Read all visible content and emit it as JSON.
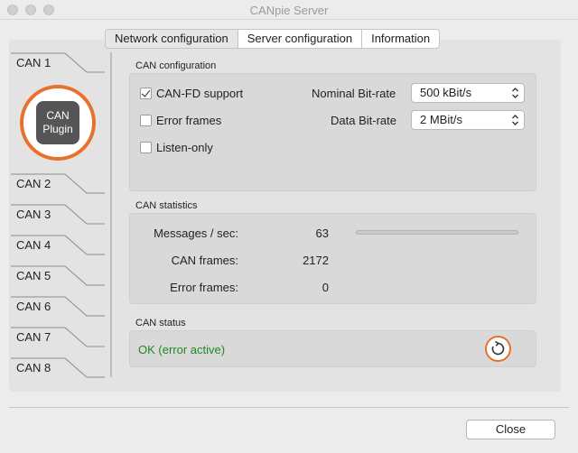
{
  "window": {
    "title": "CANpie Server"
  },
  "tabs": [
    "Network configuration",
    "Server configuration",
    "Information"
  ],
  "channels": [
    "CAN 1",
    "CAN 2",
    "CAN 3",
    "CAN 4",
    "CAN 5",
    "CAN 6",
    "CAN 7",
    "CAN 8"
  ],
  "plugin": {
    "line1": "CAN",
    "line2": "Plugin"
  },
  "can_config": {
    "title": "CAN configuration",
    "canfd_label": "CAN-FD support",
    "canfd_checked": true,
    "error_frames_label": "Error frames",
    "error_frames_checked": false,
    "listen_only_label": "Listen-only",
    "listen_only_checked": false,
    "nominal_label": "Nominal Bit-rate",
    "nominal_value": "500 kBit/s",
    "data_label": "Data Bit-rate",
    "data_value": "2 MBit/s"
  },
  "can_stats": {
    "title": "CAN statistics",
    "msg_label": "Messages / sec:",
    "msg_value": "63",
    "frames_label": "CAN frames:",
    "frames_value": "2172",
    "errors_label": "Error frames:",
    "errors_value": "0",
    "load_fraction": 0
  },
  "can_status": {
    "title": "CAN status",
    "text": "OK (error active)"
  },
  "footer": {
    "close_label": "Close"
  },
  "colors": {
    "accent": "#e8722a",
    "status_ok": "#1f8a1f"
  }
}
